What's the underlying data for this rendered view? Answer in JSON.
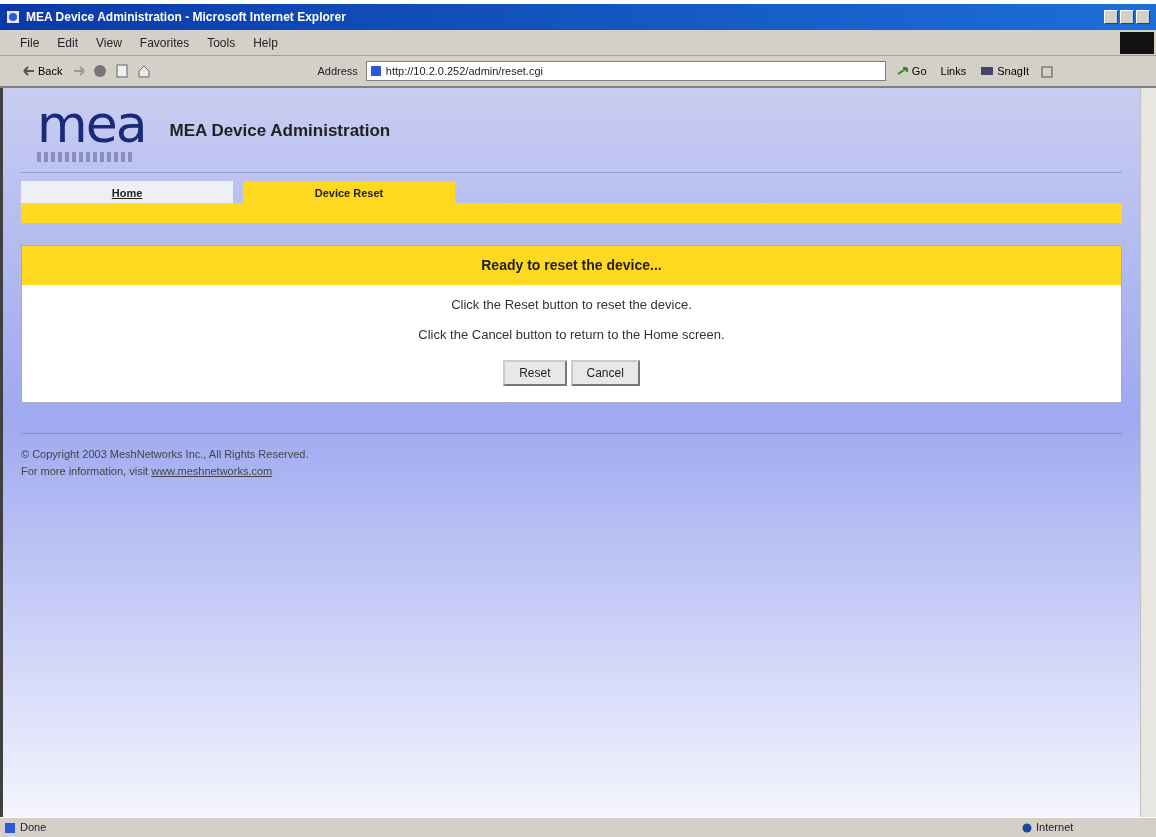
{
  "window": {
    "title": "MEA Device Administration - Microsoft Internet Explorer"
  },
  "menu": [
    "File",
    "Edit",
    "View",
    "Favorites",
    "Tools",
    "Help"
  ],
  "toolbar": {
    "back": "Back",
    "address_label": "Address",
    "address": "http://10.2.0.252/admin/reset.cgi",
    "go": "Go",
    "links": "Links",
    "snagit": "SnagIt"
  },
  "header": {
    "logo": "mea",
    "title": "MEA Device Administration"
  },
  "tabs": [
    {
      "label": "Home",
      "selected": false
    },
    {
      "label": "Device Reset",
      "selected": true
    }
  ],
  "panel": {
    "heading": "Ready to reset the device...",
    "lines": [
      "Click the Reset button to reset the device.",
      "Click the Cancel button to return to the Home screen."
    ],
    "buttons": [
      "Reset",
      "Cancel"
    ]
  },
  "footer": {
    "copyright": "© Copyright 2003 MeshNetworks Inc., All Rights Reserved.",
    "more": "For more information, visit ",
    "link": "www.meshnetworks.com"
  },
  "status_bar": {
    "text": "Done",
    "zone": "Internet"
  }
}
